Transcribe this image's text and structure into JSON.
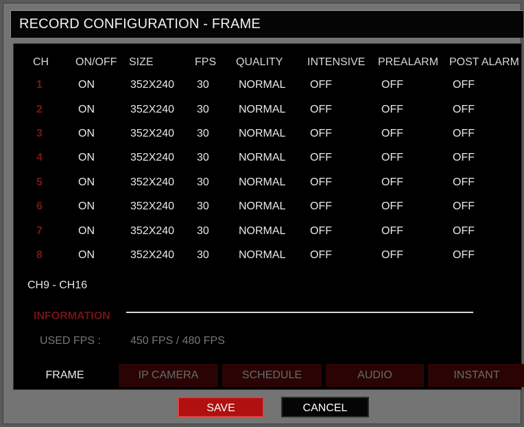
{
  "window": {
    "title": "RECORD CONFIGURATION - FRAME"
  },
  "table": {
    "headers": [
      "CH",
      "ON/OFF",
      "SIZE",
      "FPS",
      "QUALITY",
      "INTENSIVE",
      "PREALARM",
      "POST ALARM"
    ],
    "rows": [
      [
        "1",
        "ON",
        "352X240",
        "30",
        "NORMAL",
        "OFF",
        "OFF",
        "OFF"
      ],
      [
        "2",
        "ON",
        "352X240",
        "30",
        "NORMAL",
        "OFF",
        "OFF",
        "OFF"
      ],
      [
        "3",
        "ON",
        "352X240",
        "30",
        "NORMAL",
        "OFF",
        "OFF",
        "OFF"
      ],
      [
        "4",
        "ON",
        "352X240",
        "30",
        "NORMAL",
        "OFF",
        "OFF",
        "OFF"
      ],
      [
        "5",
        "ON",
        "352X240",
        "30",
        "NORMAL",
        "OFF",
        "OFF",
        "OFF"
      ],
      [
        "6",
        "ON",
        "352X240",
        "30",
        "NORMAL",
        "OFF",
        "OFF",
        "OFF"
      ],
      [
        "7",
        "ON",
        "352X240",
        "30",
        "NORMAL",
        "OFF",
        "OFF",
        "OFF"
      ],
      [
        "8",
        "ON",
        "352X240",
        "30",
        "NORMAL",
        "OFF",
        "OFF",
        "OFF"
      ]
    ]
  },
  "page_range": "CH9 - CH16",
  "information": {
    "label": "INFORMATION",
    "used_fps_label": "USED FPS :",
    "used_fps_value": "450 FPS / 480 FPS"
  },
  "tabs": [
    {
      "label": "FRAME",
      "active": true
    },
    {
      "label": "IP CAMERA",
      "active": false
    },
    {
      "label": "SCHEDULE",
      "active": false
    },
    {
      "label": "AUDIO",
      "active": false
    },
    {
      "label": "INSTANT",
      "active": false
    }
  ],
  "buttons": {
    "save": "SAVE",
    "cancel": "CANCEL"
  },
  "colors": {
    "save_bg": "#b01010",
    "channel_number": "#7a1515",
    "inactive_tab": "#2a0404",
    "panel_bg": "#000000",
    "frame_bg": "#747474"
  }
}
